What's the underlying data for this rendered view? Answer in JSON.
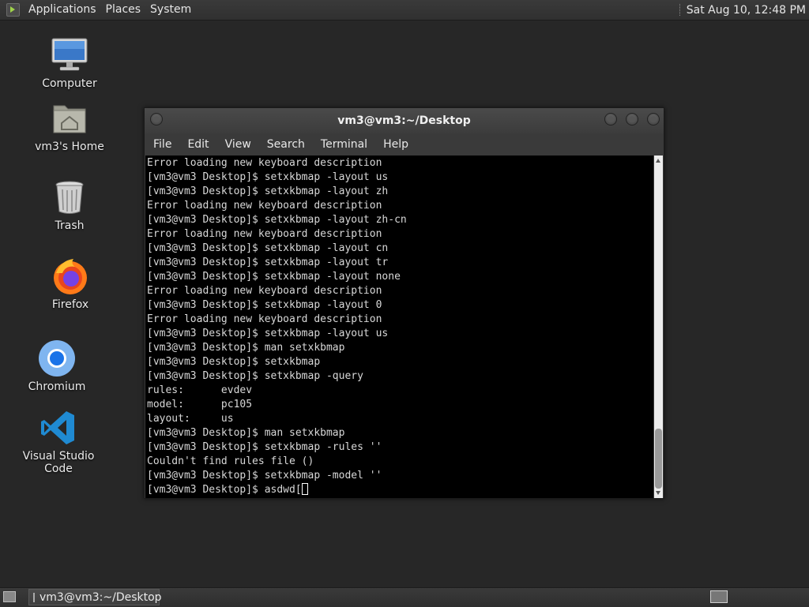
{
  "top_panel": {
    "menu": [
      "Applications",
      "Places",
      "System"
    ],
    "clock": "Sat Aug 10, 12:48 PM"
  },
  "desktop_icons": [
    {
      "label": "Computer",
      "icon": "computer-icon"
    },
    {
      "label": "vm3's Home",
      "icon": "home-folder-icon"
    },
    {
      "label": "Trash",
      "icon": "trash-icon"
    },
    {
      "label": "Firefox",
      "icon": "firefox-icon"
    },
    {
      "label": "Chromium",
      "icon": "chromium-icon"
    },
    {
      "label": "Visual Studio Code",
      "icon": "vscode-icon"
    }
  ],
  "terminal": {
    "title": "vm3@vm3:~/Desktop",
    "menu": [
      "File",
      "Edit",
      "View",
      "Search",
      "Terminal",
      "Help"
    ],
    "lines": [
      "Error loading new keyboard description",
      "[vm3@vm3 Desktop]$ setxkbmap -layout us",
      "[vm3@vm3 Desktop]$ setxkbmap -layout zh",
      "Error loading new keyboard description",
      "[vm3@vm3 Desktop]$ setxkbmap -layout zh-cn",
      "Error loading new keyboard description",
      "[vm3@vm3 Desktop]$ setxkbmap -layout cn",
      "[vm3@vm3 Desktop]$ setxkbmap -layout tr",
      "[vm3@vm3 Desktop]$ setxkbmap -layout none",
      "Error loading new keyboard description",
      "[vm3@vm3 Desktop]$ setxkbmap -layout 0",
      "Error loading new keyboard description",
      "[vm3@vm3 Desktop]$ setxkbmap -layout us",
      "[vm3@vm3 Desktop]$ man setxkbmap",
      "[vm3@vm3 Desktop]$ setxkbmap",
      "[vm3@vm3 Desktop]$ setxkbmap -query",
      "rules:      evdev",
      "model:      pc105",
      "layout:     us",
      "[vm3@vm3 Desktop]$ man setxkbmap",
      "[vm3@vm3 Desktop]$ setxkbmap -rules ''",
      "Couldn't find rules file ()",
      "[vm3@vm3 Desktop]$ setxkbmap -model ''"
    ],
    "prompt_line": "[vm3@vm3 Desktop]$ asdwd["
  },
  "taskbar": {
    "task_label": "vm3@vm3:~/Desktop"
  },
  "colors": {
    "desktop_bg": "#272727",
    "panel_bg": "#333333",
    "terminal_bg": "#000000",
    "terminal_fg": "#d8d8d8"
  }
}
